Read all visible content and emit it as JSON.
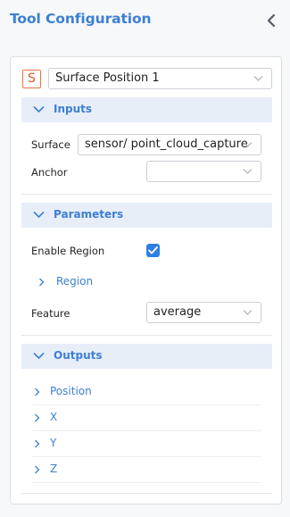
{
  "header": {
    "title": "Tool Configuration",
    "collapse_icon": "chevron-left-icon"
  },
  "tool": {
    "letter": "S",
    "letter_color": "#e05a26",
    "selected": "Surface Position 1"
  },
  "inputs": {
    "label": "Inputs",
    "surface_label": "Surface",
    "surface_value": "sensor/ point_cloud_capture",
    "anchor_label": "Anchor",
    "anchor_value": ""
  },
  "parameters": {
    "label": "Parameters",
    "enable_region_label": "Enable Region",
    "enable_region_checked": true,
    "region_label": "Region",
    "feature_label": "Feature",
    "feature_value": "average"
  },
  "outputs": {
    "label": "Outputs",
    "items": [
      {
        "label": "Position"
      },
      {
        "label": "X"
      },
      {
        "label": "Y"
      },
      {
        "label": "Z"
      }
    ]
  },
  "colors": {
    "accent": "#3d7fd3",
    "section_bg": "#e7eef8",
    "checkbox": "#2f7fe0"
  }
}
